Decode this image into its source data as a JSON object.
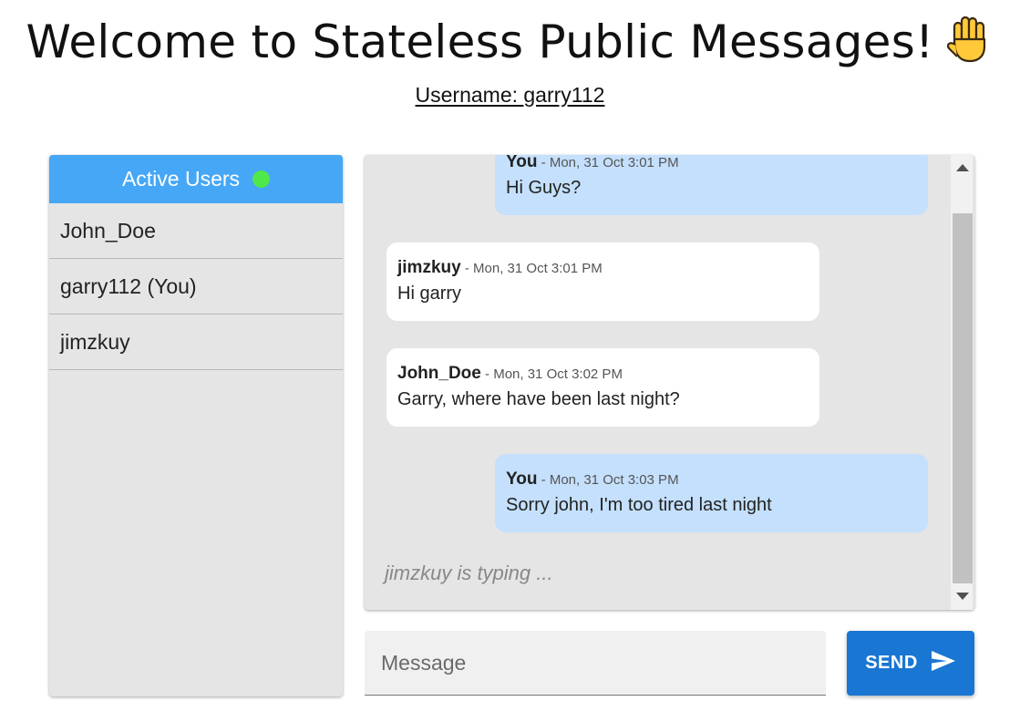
{
  "header": {
    "title": "Welcome to Stateless Public Messages!",
    "title_icon": "raised-hand-icon",
    "username": "Username: garry112"
  },
  "users_panel": {
    "title": "Active Users",
    "status_color": "#4fe84a",
    "header_color": "#45a7f5",
    "users": [
      "John_Doe",
      "garry112 (You)",
      "jimzkuy"
    ]
  },
  "messages": [
    {
      "author": "You",
      "sep": " - ",
      "time": "Mon, 31 Oct 3:01 PM",
      "text": "Hi Guys?",
      "mine": true
    },
    {
      "author": "jimzkuy",
      "sep": " - ",
      "time": "Mon, 31 Oct 3:01 PM",
      "text": "Hi garry",
      "mine": false
    },
    {
      "author": "John_Doe",
      "sep": " - ",
      "time": "Mon, 31 Oct 3:02 PM",
      "text": "Garry, where have been last night?",
      "mine": false
    },
    {
      "author": "You",
      "sep": " - ",
      "time": "Mon, 31 Oct 3:03 PM",
      "text": "Sorry john, I'm too tired last night",
      "mine": true
    }
  ],
  "typing_indicator": "jimzkuy is typing ...",
  "composer": {
    "placeholder": "Message",
    "send_label": "SEND",
    "send_icon": "send-arrow-icon",
    "send_color": "#1976d2"
  }
}
